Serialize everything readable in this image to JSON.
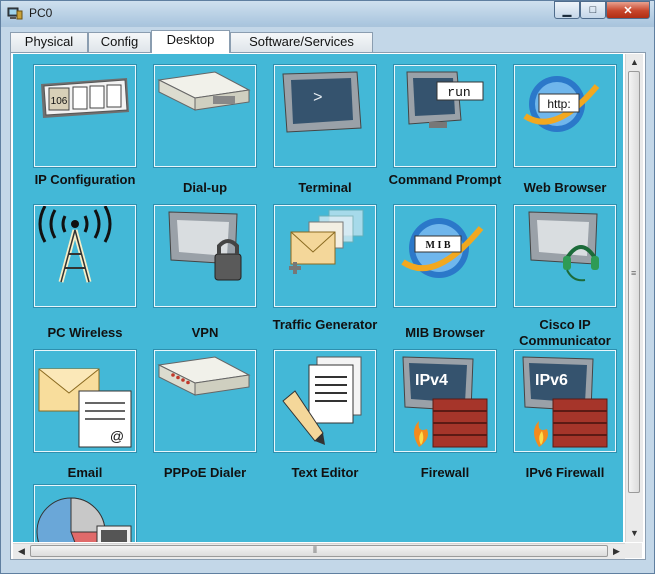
{
  "window": {
    "title": "PC0",
    "icon": "pc-app-icon"
  },
  "caption_buttons": {
    "minimize": "▁",
    "maximize": "□",
    "close": "✕"
  },
  "tabs": [
    {
      "label": "Physical",
      "active": false
    },
    {
      "label": "Config",
      "active": false
    },
    {
      "label": "Desktop",
      "active": true
    },
    {
      "label": "Software/Services",
      "active": false
    }
  ],
  "apps": [
    {
      "label": "IP Configuration",
      "icon": "ip-configuration-icon",
      "badge": "106"
    },
    {
      "label": "Dial-up",
      "icon": "dial-up-modem-icon"
    },
    {
      "label": "Terminal",
      "icon": "terminal-icon",
      "badge": ">"
    },
    {
      "label": "Command Prompt",
      "icon": "command-prompt-icon",
      "badge": "run"
    },
    {
      "label": "Web Browser",
      "icon": "web-browser-icon",
      "badge": "http:"
    },
    {
      "label": "PC Wireless",
      "icon": "wireless-tower-icon"
    },
    {
      "label": "VPN",
      "icon": "vpn-lock-icon"
    },
    {
      "label": "Traffic Generator",
      "icon": "traffic-generator-icon"
    },
    {
      "label": "MIB Browser",
      "icon": "mib-browser-icon",
      "badge": "M I B"
    },
    {
      "label": "Cisco IP Communicator",
      "icon": "ip-communicator-headset-icon"
    },
    {
      "label": "Email",
      "icon": "email-icon",
      "badge": "@"
    },
    {
      "label": "PPPoE Dialer",
      "icon": "pppoe-dialer-icon"
    },
    {
      "label": "Text Editor",
      "icon": "text-editor-icon"
    },
    {
      "label": "Firewall",
      "icon": "firewall-icon",
      "badge": "IPv4"
    },
    {
      "label": "IPv6 Firewall",
      "icon": "ipv6-firewall-icon",
      "badge": "IPv6"
    },
    {
      "label": "",
      "icon": "pie-chart-app-icon"
    }
  ],
  "colors": {
    "desktop_bg": "#43b8d7",
    "tile_border": "#e9f6fb"
  }
}
